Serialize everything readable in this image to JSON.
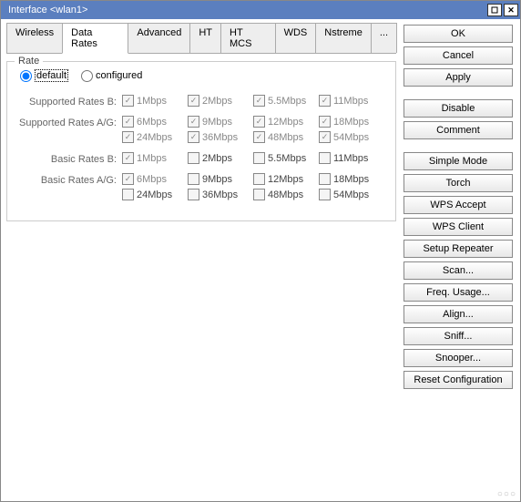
{
  "title": "Interface <wlan1>",
  "tabs": [
    "Wireless",
    "Data Rates",
    "Advanced",
    "HT",
    "HT MCS",
    "WDS",
    "Nstreme",
    "..."
  ],
  "active_tab": 1,
  "fieldset_legend": "Rate",
  "radio": {
    "default": "default",
    "configured": "configured",
    "selected": "default"
  },
  "rows": [
    {
      "label": "Supported Rates B:",
      "opts": [
        {
          "t": "1Mbps",
          "c": true
        },
        {
          "t": "2Mbps",
          "c": true
        },
        {
          "t": "5.5Mbps",
          "c": true
        },
        {
          "t": "11Mbps",
          "c": true
        }
      ]
    },
    {
      "label": "Supported Rates A/G:",
      "opts": [
        {
          "t": "6Mbps",
          "c": true
        },
        {
          "t": "9Mbps",
          "c": true
        },
        {
          "t": "12Mbps",
          "c": true
        },
        {
          "t": "18Mbps",
          "c": true
        },
        {
          "t": "24Mbps",
          "c": true
        },
        {
          "t": "36Mbps",
          "c": true
        },
        {
          "t": "48Mbps",
          "c": true
        },
        {
          "t": "54Mbps",
          "c": true
        }
      ]
    },
    {
      "label": "Basic Rates B:",
      "opts": [
        {
          "t": "1Mbps",
          "c": true
        },
        {
          "t": "2Mbps",
          "c": false
        },
        {
          "t": "5.5Mbps",
          "c": false
        },
        {
          "t": "11Mbps",
          "c": false
        }
      ]
    },
    {
      "label": "Basic Rates A/G:",
      "opts": [
        {
          "t": "6Mbps",
          "c": true
        },
        {
          "t": "9Mbps",
          "c": false
        },
        {
          "t": "12Mbps",
          "c": false
        },
        {
          "t": "18Mbps",
          "c": false
        },
        {
          "t": "24Mbps",
          "c": false
        },
        {
          "t": "36Mbps",
          "c": false
        },
        {
          "t": "48Mbps",
          "c": false
        },
        {
          "t": "54Mbps",
          "c": false
        }
      ]
    }
  ],
  "buttons": [
    "OK",
    "Cancel",
    "Apply",
    "",
    "Disable",
    "Comment",
    "",
    "Simple Mode",
    "Torch",
    "WPS Accept",
    "WPS Client",
    "Setup Repeater",
    "Scan...",
    "Freq. Usage...",
    "Align...",
    "Sniff...",
    "Snooper...",
    "Reset Configuration"
  ]
}
